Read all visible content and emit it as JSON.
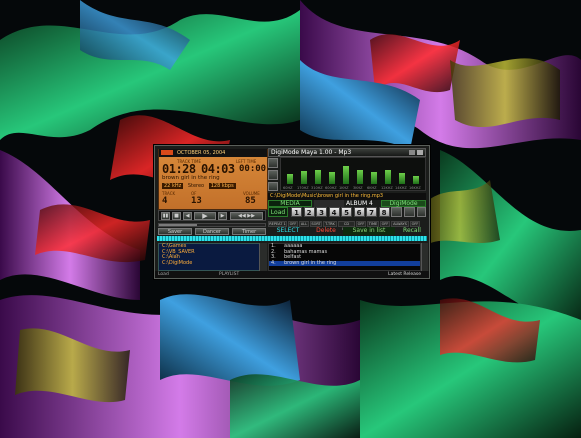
{
  "player": {
    "date": "OCTOBER 05, 2004",
    "time_labels": [
      "TRACK TIME",
      "LEFT TIME"
    ],
    "track_time": "01:28",
    "total_time": "04:03",
    "left_time": "00:00",
    "song": "brown girl in the ring",
    "format": "22 kHz",
    "mode": "Stereo",
    "bitrate": "128 kbps",
    "track_label": "TRACK",
    "track_num": "4",
    "of_label": "OF",
    "of_num": "13",
    "volume_label": "VOLUME",
    "volume": "85",
    "buttons": {
      "saver": "Saver",
      "dancer": "Dancer",
      "timer": "Timer"
    }
  },
  "titlebar": {
    "title": "DigiMode Maya 1.00 - Mp3"
  },
  "equalizer": {
    "labels": [
      "60HZ",
      "170HZ",
      "310HZ",
      "600HZ",
      "1KHZ",
      "3KHZ",
      "6KHZ",
      "12KHZ",
      "14KHZ",
      "16KHZ"
    ],
    "levels": [
      0.42,
      0.55,
      0.6,
      0.5,
      0.75,
      0.58,
      0.5,
      0.6,
      0.45,
      0.35
    ]
  },
  "path": "C:\\DigiMode\\Music\\brown girl in the ring.mp3",
  "media_bar": {
    "media": "MEDIA",
    "album": "ALBUM 4",
    "digimode": "DigiMode"
  },
  "numbers": [
    "1",
    "2",
    "3",
    "4",
    "5",
    "6",
    "7",
    "8"
  ],
  "load_label": "Load",
  "options": [
    "REPEAT 1",
    "OFF",
    "ALL",
    "SORT",
    "T.TRK",
    "CD CASE",
    "OFF",
    "TIME",
    "OFF",
    "ALWAYS",
    "OFF"
  ],
  "actions": {
    "select": "SELECT",
    "delete": "Delete",
    "save": "Save in list",
    "recall": "Recall"
  },
  "directories": [
    "C:\\Games",
    "C:\\VB_SAVER",
    "C:\\Alan",
    "C:\\DigiMode"
  ],
  "playlist": [
    {
      "num": "1.",
      "title": "aaaaaa"
    },
    {
      "num": "2.",
      "title": "bahamas mamas"
    },
    {
      "num": "3.",
      "title": "belfast"
    },
    {
      "num": "4.",
      "title": "brown girl in the ring"
    }
  ],
  "status": {
    "left": "Load",
    "middle": "PLAYLIST",
    "right": "Latest Release"
  },
  "colors": {
    "lcd": "#d98a3a",
    "accent": "#2fe1e9",
    "eq_bar": "#6ecf4a"
  }
}
